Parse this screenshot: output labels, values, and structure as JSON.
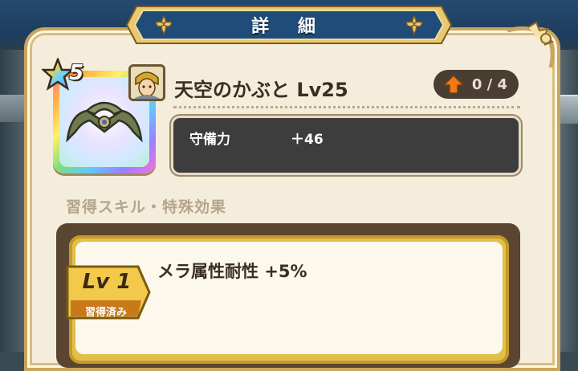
{
  "dialog": {
    "title": "詳 細"
  },
  "item": {
    "name": "天空のかぶと Lv25",
    "rarity": "5",
    "icon": "helmet-icon",
    "portrait_icon": "hero-portrait-icon"
  },
  "upgrade": {
    "count": "0 / 4",
    "icon": "up-arrow-icon"
  },
  "stats": [
    {
      "label": "守備力",
      "value": "＋46"
    }
  ],
  "section": {
    "heading": "習得スキル・特殊効果"
  },
  "skills": [
    {
      "level": "Lv 1",
      "status": "習得済み",
      "effect": "メラ属性耐性 +5%"
    }
  ],
  "colors": {
    "panel": "#f4eddc",
    "banner": "#1f4c78",
    "accent_gold": "#e0bf4a",
    "stat_box": "#3d3d3d",
    "upgrade_arrow": "#f07a1a"
  }
}
